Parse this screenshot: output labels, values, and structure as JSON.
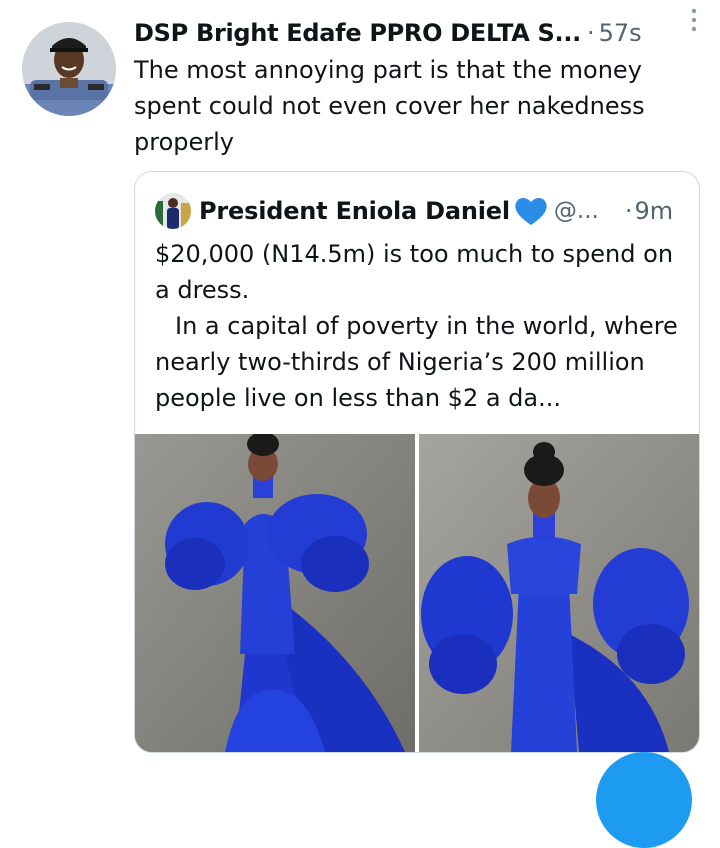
{
  "tweet": {
    "author_name": "DSP Bright Edafe PPRO DELTA S...",
    "separator": "·",
    "time": "57s",
    "text": "The most annoying part is that the money spent could not even cover her nakedness properly",
    "avatar_icon": "police-officer-avatar",
    "more_icon": "vertical-ellipsis-icon"
  },
  "quoted_tweet": {
    "author_name": "President Eniola Daniel",
    "badge_icon": "blue-heart-icon",
    "handle": "@...",
    "separator": "·",
    "time": "9m",
    "paragraph_1": "$20,000 (N14.5m) is too much to spend on a dress.",
    "paragraph_2": "In a capital of poverty in the world, where nearly two-thirds of Nigeria’s 200 million people live on less than $2 a da...",
    "media": [
      {
        "description_icon": "photo-woman-blue-gown-left"
      },
      {
        "description_icon": "photo-woman-blue-gown-right"
      }
    ]
  },
  "colors": {
    "text_primary": "#0f1419",
    "text_secondary": "#536471",
    "border": "#cfd9de",
    "accent": "#1d9bf0",
    "gown_blue": "#1d34c9"
  }
}
